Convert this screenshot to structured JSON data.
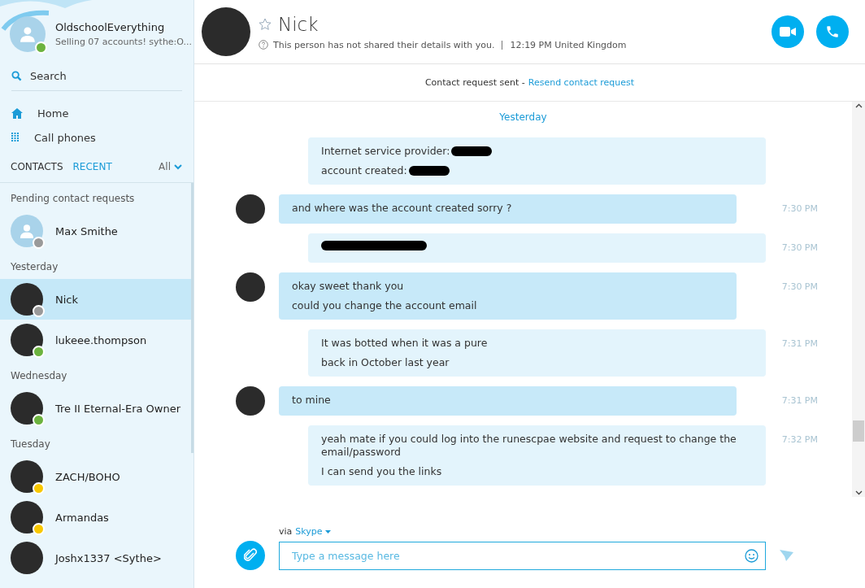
{
  "profile": {
    "name": "OldschoolEverything",
    "mood": "Selling 07 accounts! sythe:O...",
    "color": "#6cb33f"
  },
  "search": {
    "label": "Search"
  },
  "nav": [
    {
      "label": "Home",
      "kind": "home"
    },
    {
      "label": "Call phones",
      "kind": "dialpad"
    }
  ],
  "tabs": [
    {
      "label": "CONTACTS",
      "selected": false
    },
    {
      "label": "RECENT",
      "selected": true
    }
  ],
  "filter": {
    "label": "All"
  },
  "sections": [
    {
      "title": "Pending contact requests",
      "contacts": [
        {
          "name": "Max Smithe",
          "kind": "default",
          "color": "#9a9a9a",
          "selected": false
        }
      ]
    },
    {
      "title": "Yesterday",
      "contacts": [
        {
          "name": "Nick",
          "kind": "photo",
          "color": "#9a9a9a",
          "selected": true
        },
        {
          "name": "lukeee.thompson",
          "kind": "photo",
          "color": "#6cb33f",
          "selected": false
        }
      ]
    },
    {
      "title": "Wednesday",
      "contacts": [
        {
          "name": "Tre II Eternal-Era Owner",
          "kind": "photo",
          "color": "#6cb33f",
          "selected": false
        }
      ]
    },
    {
      "title": "Tuesday",
      "contacts": [
        {
          "name": "ZACH/BOHO",
          "kind": "photo",
          "color": "#f8c800",
          "selected": false
        },
        {
          "name": "Armandas",
          "kind": "photo",
          "color": "#f8c800",
          "selected": false
        },
        {
          "name": "Joshx1337 <Sythe>",
          "kind": "photo",
          "selected": false
        }
      ]
    }
  ],
  "chat": {
    "name": "Nick",
    "details": "This person has not shared their details with you.",
    "local_time": "12:19 PM United Kingdom"
  },
  "request_bar": {
    "text": "Contact request sent -",
    "link": "Resend contact request"
  },
  "day_divider": "Yesterday",
  "messages": [
    {
      "kind": "sent",
      "lines": [
        {
          "text": "Internet service provider:",
          "redacted": true
        },
        {
          "text": "account created:",
          "redacted": true
        }
      ]
    },
    {
      "kind": "received",
      "time": "7:30 PM",
      "lines": [
        {
          "text": "and where was the account created sorry ?",
          "redacted": false
        }
      ]
    },
    {
      "kind": "sent",
      "time": "7:30 PM",
      "lines": [
        {
          "redacted": true
        }
      ]
    },
    {
      "kind": "received",
      "time": "7:30 PM",
      "lines": [
        {
          "text": "okay sweet thank you",
          "redacted": false
        },
        {
          "text": "could you change the account email",
          "redacted": false
        }
      ]
    },
    {
      "kind": "sent",
      "time": "7:31 PM",
      "lines": [
        {
          "text": "It was botted when it was a pure",
          "redacted": false
        },
        {
          "text": "back in October last year",
          "redacted": false
        }
      ]
    },
    {
      "kind": "received",
      "time": "7:31 PM",
      "lines": [
        {
          "text": "to mine",
          "redacted": false
        }
      ]
    },
    {
      "kind": "sent",
      "time": "7:32 PM",
      "lines": [
        {
          "text": "yeah mate if you could log into the runescpae website and request to change the email/password",
          "redacted": false
        },
        {
          "text": "I can send you the links",
          "redacted": false
        }
      ]
    }
  ],
  "composer": {
    "via": "via",
    "service": "Skype",
    "placeholder": "Type a message here"
  }
}
